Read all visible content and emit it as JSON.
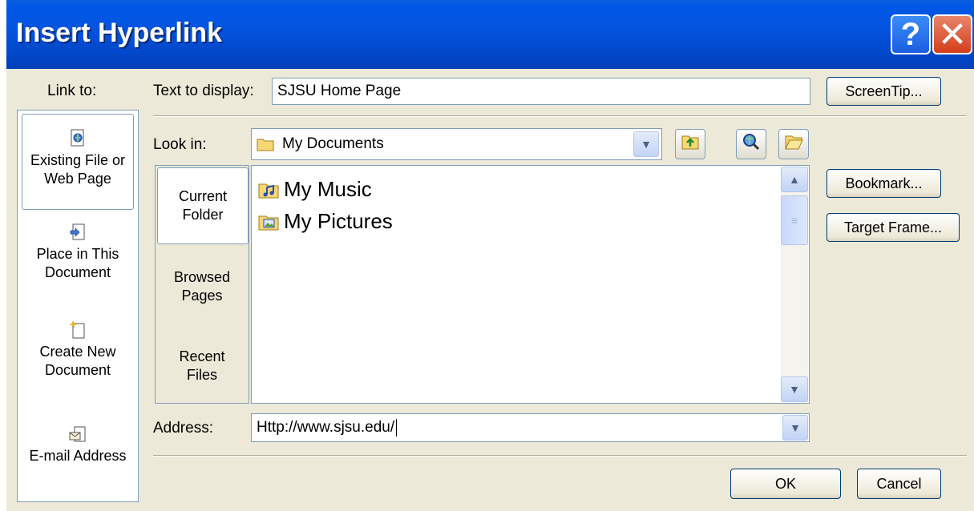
{
  "window": {
    "title": "Insert Hyperlink",
    "help_glyph": "?",
    "close_glyph": "✕"
  },
  "link_to": {
    "label": "Link to:",
    "items": [
      {
        "line1": "Existing File or",
        "line2": "Web Page",
        "icon": "web-file-icon"
      },
      {
        "line1": "Place in This",
        "line2": "Document",
        "icon": "place-in-document-icon"
      },
      {
        "line1": "Create New",
        "line2": "Document",
        "icon": "new-document-icon"
      },
      {
        "line1": "E-mail Address",
        "line2": "",
        "icon": "email-icon"
      }
    ]
  },
  "text_to_display": {
    "label": "Text to display:",
    "value": "SJSU Home Page"
  },
  "look_in": {
    "label": "Look in:",
    "value": "My Documents"
  },
  "tabs": [
    {
      "line1": "Current",
      "line2": "Folder"
    },
    {
      "line1": "Browsed",
      "line2": "Pages"
    },
    {
      "line1": "Recent",
      "line2": "Files"
    }
  ],
  "files": [
    {
      "name": "My Music",
      "icon": "music-folder-icon"
    },
    {
      "name": "My Pictures",
      "icon": "pictures-folder-icon"
    }
  ],
  "address": {
    "label": "Address:",
    "value": "Http://www.sjsu.edu/"
  },
  "buttons": {
    "screentip": "ScreenTip...",
    "bookmark": "Bookmark...",
    "target_frame": "Target Frame...",
    "ok": "OK",
    "cancel": "Cancel"
  },
  "colors": {
    "titlebar": "#0054e3",
    "dialog_bg": "#ece9d8",
    "field_border": "#7f9db9"
  }
}
